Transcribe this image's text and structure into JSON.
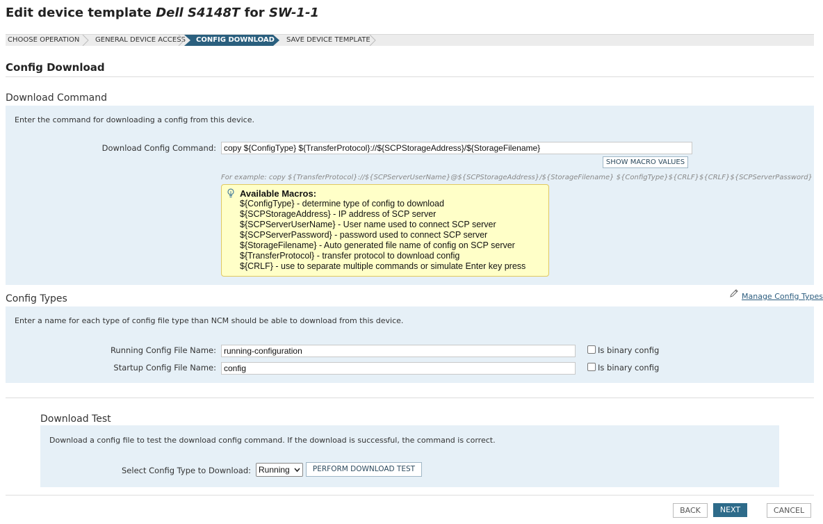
{
  "page": {
    "title_prefix": "Edit device template ",
    "title_device": "Dell S4148T",
    "title_mid": " for ",
    "title_node": "SW-1-1"
  },
  "wizard": {
    "steps": [
      {
        "label": "CHOOSE OPERATION",
        "active": false
      },
      {
        "label": "GENERAL DEVICE ACCESS",
        "active": false
      },
      {
        "label": "CONFIG DOWNLOAD",
        "active": true
      },
      {
        "label": "SAVE DEVICE TEMPLATE",
        "active": false
      }
    ],
    "colors": {
      "active": "#2a5f7e",
      "inactive": "#ececec"
    }
  },
  "section_title": "Config Download",
  "download_command": {
    "title": "Download Command",
    "description": "Enter the command for downloading a config from this device.",
    "label": "Download Config Command:",
    "value": "copy ${ConfigType} ${TransferProtocol}://${SCPStorageAddress}/${StorageFilename}",
    "show_macro_button": "SHOW MACRO VALUES",
    "example": "For example: copy ${TransferProtocol}://${SCPServerUserName}@${SCPStorageAddress}/${StorageFilename} ${ConfigType}${CRLF}${CRLF}${SCPServerPassword}"
  },
  "macros": {
    "title": "Available Macros:",
    "icon": "lightbulb-icon",
    "items": [
      "${ConfigType} - determine type of config to download",
      "${SCPStorageAddress} - IP address of SCP server",
      "${SCPServerUserName} - User name used to connect SCP server",
      "${SCPServerPassword} - password used to connect SCP server",
      "${StorageFilename} - Auto generated file name of config on SCP server",
      "${TransferProtocol} - transfer protocol to download config",
      "${CRLF} - use to separate multiple commands or simulate Enter key press"
    ]
  },
  "config_types": {
    "title": "Config Types",
    "manage_link": "Manage Config Types",
    "description": "Enter a name for each type of config file type than NCM should be able to download from this device.",
    "running_label": "Running Config File Name:",
    "running_value": "running-configuration",
    "startup_label": "Startup Config File Name:",
    "startup_value": "config",
    "binary_label": "Is binary config"
  },
  "download_test": {
    "title": "Download Test",
    "description": "Download a config file to test the download config command. If the download is successful, the command is correct.",
    "select_label": "Select Config Type to Download:",
    "select_value": "Running",
    "perform_button": "PERFORM DOWNLOAD TEST"
  },
  "footer": {
    "back": "BACK",
    "next": "NEXT",
    "cancel": "CANCEL"
  }
}
